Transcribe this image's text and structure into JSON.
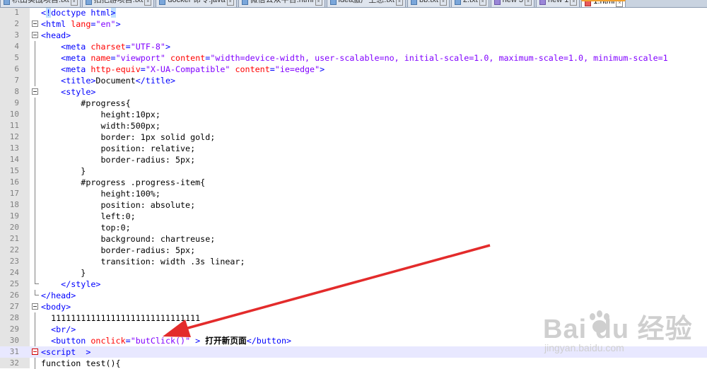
{
  "tabs": [
    {
      "label": "积由实战项目.txt",
      "icon": "file-icon",
      "active": false
    },
    {
      "label": "拍把游项目.txt",
      "icon": "file-icon",
      "active": false
    },
    {
      "label": "docker 命令.java",
      "icon": "file-icon",
      "active": false
    },
    {
      "label": "微信公众平台.html",
      "icon": "file-icon",
      "active": false
    },
    {
      "label": "idea激产生总.txt",
      "icon": "file-icon",
      "active": false
    },
    {
      "label": "bb.txt",
      "icon": "file-icon",
      "active": false
    },
    {
      "label": "2.txt",
      "icon": "file-icon",
      "active": false
    },
    {
      "label": "new 3",
      "icon": "file-icon",
      "active": false
    },
    {
      "label": "new 1",
      "icon": "file-icon",
      "active": false
    },
    {
      "label": "1.html",
      "icon": "file-icon",
      "active": true
    }
  ],
  "lines": [
    {
      "n": "1",
      "fold": "",
      "segs": [
        [
          "tg",
          "<"
        ],
        [
          "caret tg",
          "!"
        ],
        [
          "tg",
          "doctype html"
        ],
        [
          "caret tg",
          ">"
        ]
      ]
    },
    {
      "n": "2",
      "fold": "box",
      "segs": [
        [
          "tg",
          "<html "
        ],
        [
          "at",
          "lang"
        ],
        [
          "tg",
          "="
        ],
        [
          "vl",
          "\"en\""
        ],
        [
          "tg",
          ">"
        ]
      ]
    },
    {
      "n": "3",
      "fold": "box",
      "segs": [
        [
          "tg",
          "<head>"
        ]
      ]
    },
    {
      "n": "4",
      "fold": "vline",
      "segs": [
        [
          "tx",
          "    "
        ],
        [
          "tg",
          "<meta "
        ],
        [
          "at",
          "charset"
        ],
        [
          "tg",
          "="
        ],
        [
          "vl",
          "\"UTF-8\""
        ],
        [
          "tg",
          ">"
        ]
      ]
    },
    {
      "n": "5",
      "fold": "vline",
      "segs": [
        [
          "tx",
          "    "
        ],
        [
          "tg",
          "<meta "
        ],
        [
          "at",
          "name"
        ],
        [
          "tg",
          "="
        ],
        [
          "vl",
          "\"viewport\""
        ],
        [
          "tg",
          " "
        ],
        [
          "at",
          "content"
        ],
        [
          "tg",
          "="
        ],
        [
          "vl",
          "\"width=device-width, user-scalable=no, initial-scale=1.0, maximum-scale=1.0, minimum-scale=1"
        ]
      ]
    },
    {
      "n": "6",
      "fold": "vline",
      "segs": [
        [
          "tx",
          "    "
        ],
        [
          "tg",
          "<meta "
        ],
        [
          "at",
          "http-equiv"
        ],
        [
          "tg",
          "="
        ],
        [
          "vl",
          "\"X-UA-Compatible\""
        ],
        [
          "tg",
          " "
        ],
        [
          "at",
          "content"
        ],
        [
          "tg",
          "="
        ],
        [
          "vl",
          "\"ie=edge\""
        ],
        [
          "tg",
          ">"
        ]
      ]
    },
    {
      "n": "7",
      "fold": "vline",
      "segs": [
        [
          "tx",
          "    "
        ],
        [
          "tg",
          "<title>"
        ],
        [
          "tx",
          "Document"
        ],
        [
          "tg",
          "</title>"
        ]
      ]
    },
    {
      "n": "8",
      "fold": "box",
      "segs": [
        [
          "tx",
          "    "
        ],
        [
          "tg",
          "<style>"
        ]
      ]
    },
    {
      "n": "9",
      "fold": "vline",
      "segs": [
        [
          "tx",
          "        #progress{"
        ]
      ]
    },
    {
      "n": "10",
      "fold": "vline",
      "segs": [
        [
          "tx",
          "            height:10px;"
        ]
      ]
    },
    {
      "n": "11",
      "fold": "vline",
      "segs": [
        [
          "tx",
          "            width:500px;"
        ]
      ]
    },
    {
      "n": "12",
      "fold": "vline",
      "segs": [
        [
          "tx",
          "            border: 1px solid gold;"
        ]
      ]
    },
    {
      "n": "13",
      "fold": "vline",
      "segs": [
        [
          "tx",
          "            position: relative;"
        ]
      ]
    },
    {
      "n": "14",
      "fold": "vline",
      "segs": [
        [
          "tx",
          "            border-radius: 5px;"
        ]
      ]
    },
    {
      "n": "15",
      "fold": "vline",
      "segs": [
        [
          "tx",
          "        }"
        ]
      ]
    },
    {
      "n": "16",
      "fold": "vline",
      "segs": [
        [
          "tx",
          "        #progress .progress-item{"
        ]
      ]
    },
    {
      "n": "17",
      "fold": "vline",
      "segs": [
        [
          "tx",
          "            height:100%;"
        ]
      ]
    },
    {
      "n": "18",
      "fold": "vline",
      "segs": [
        [
          "tx",
          "            position: absolute;"
        ]
      ]
    },
    {
      "n": "19",
      "fold": "vline",
      "segs": [
        [
          "tx",
          "            left:0;"
        ]
      ]
    },
    {
      "n": "20",
      "fold": "vline",
      "segs": [
        [
          "tx",
          "            top:0;"
        ]
      ]
    },
    {
      "n": "21",
      "fold": "vline",
      "segs": [
        [
          "tx",
          "            background: chartreuse;"
        ]
      ]
    },
    {
      "n": "22",
      "fold": "vline",
      "segs": [
        [
          "tx",
          "            border-radius: 5px;"
        ]
      ]
    },
    {
      "n": "23",
      "fold": "vline",
      "segs": [
        [
          "tx",
          "            transition: width .3s linear;"
        ]
      ]
    },
    {
      "n": "24",
      "fold": "vline",
      "segs": [
        [
          "tx",
          "        }"
        ]
      ]
    },
    {
      "n": "25",
      "fold": "end",
      "segs": [
        [
          "tx",
          "    "
        ],
        [
          "tg",
          "</style>"
        ]
      ]
    },
    {
      "n": "26",
      "fold": "end",
      "segs": [
        [
          "tg",
          "</head>"
        ]
      ]
    },
    {
      "n": "27",
      "fold": "box",
      "segs": [
        [
          "tg",
          "<body>"
        ]
      ]
    },
    {
      "n": "28",
      "fold": "vline",
      "segs": [
        [
          "tx",
          "  111111111111111111111111111111"
        ]
      ]
    },
    {
      "n": "29",
      "fold": "vline",
      "segs": [
        [
          "tx",
          "  "
        ],
        [
          "tg",
          "<br/>"
        ]
      ]
    },
    {
      "n": "30",
      "fold": "vline",
      "segs": [
        [
          "tx",
          "  "
        ],
        [
          "tg",
          "<button "
        ],
        [
          "at",
          "onclick"
        ],
        [
          "tg",
          "="
        ],
        [
          "vl",
          "\"butClick()\""
        ],
        [
          "tg",
          " > "
        ],
        [
          "tx bd",
          "打开新页面"
        ],
        [
          "tg",
          "</button>"
        ]
      ]
    },
    {
      "n": "31",
      "fold": "boxred",
      "hl": true,
      "segs": [
        [
          "tg",
          "<script  >"
        ]
      ]
    },
    {
      "n": "32",
      "fold": "vline",
      "segs": [
        [
          "tx",
          "function test(){"
        ]
      ]
    }
  ],
  "watermark": {
    "brand": "Bai du 经验",
    "url": "jingyan.baidu.com"
  },
  "colors": {
    "tag": "#0000ff",
    "attr": "#ff0000",
    "value": "#8000ff",
    "arrow": "#e32b2b"
  }
}
